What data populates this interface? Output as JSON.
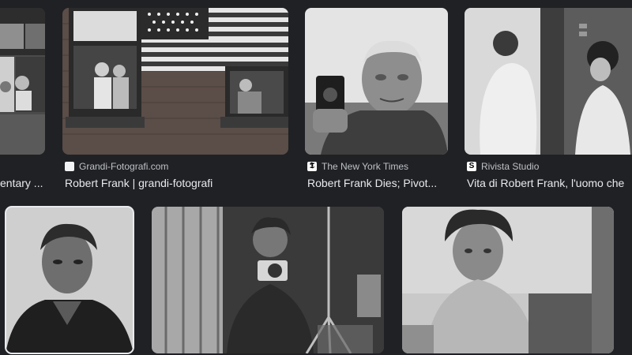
{
  "results": [
    {
      "source": "",
      "title": "entary ...",
      "alt": "Two people seen through a window"
    },
    {
      "source": "Grandi-Fotografi.com",
      "title": "Robert Frank | grandi-fotografi",
      "alt": "Brick building with American flag and figures in windows"
    },
    {
      "source": "The New York Times",
      "title": "Robert Frank Dies; Pivot...",
      "alt": "Elderly man holding a small camera"
    },
    {
      "source": "Rivista Studio",
      "title": "Vita di Robert Frank, l'uomo che",
      "alt": "People inside an elevator"
    },
    {
      "source": "",
      "title": "",
      "alt": "Portrait of a man with dark shirt"
    },
    {
      "source": "",
      "title": "",
      "alt": "Man photographing himself in a mirror with a tripod"
    },
    {
      "source": "",
      "title": "",
      "alt": "Man with wild hair seated in a chair"
    }
  ],
  "favicons": {
    "nyt": "𝕿",
    "rivista": "S"
  },
  "colors": {
    "background": "#202124",
    "title_text": "#e8eaed",
    "source_text": "#bdc1c6"
  }
}
